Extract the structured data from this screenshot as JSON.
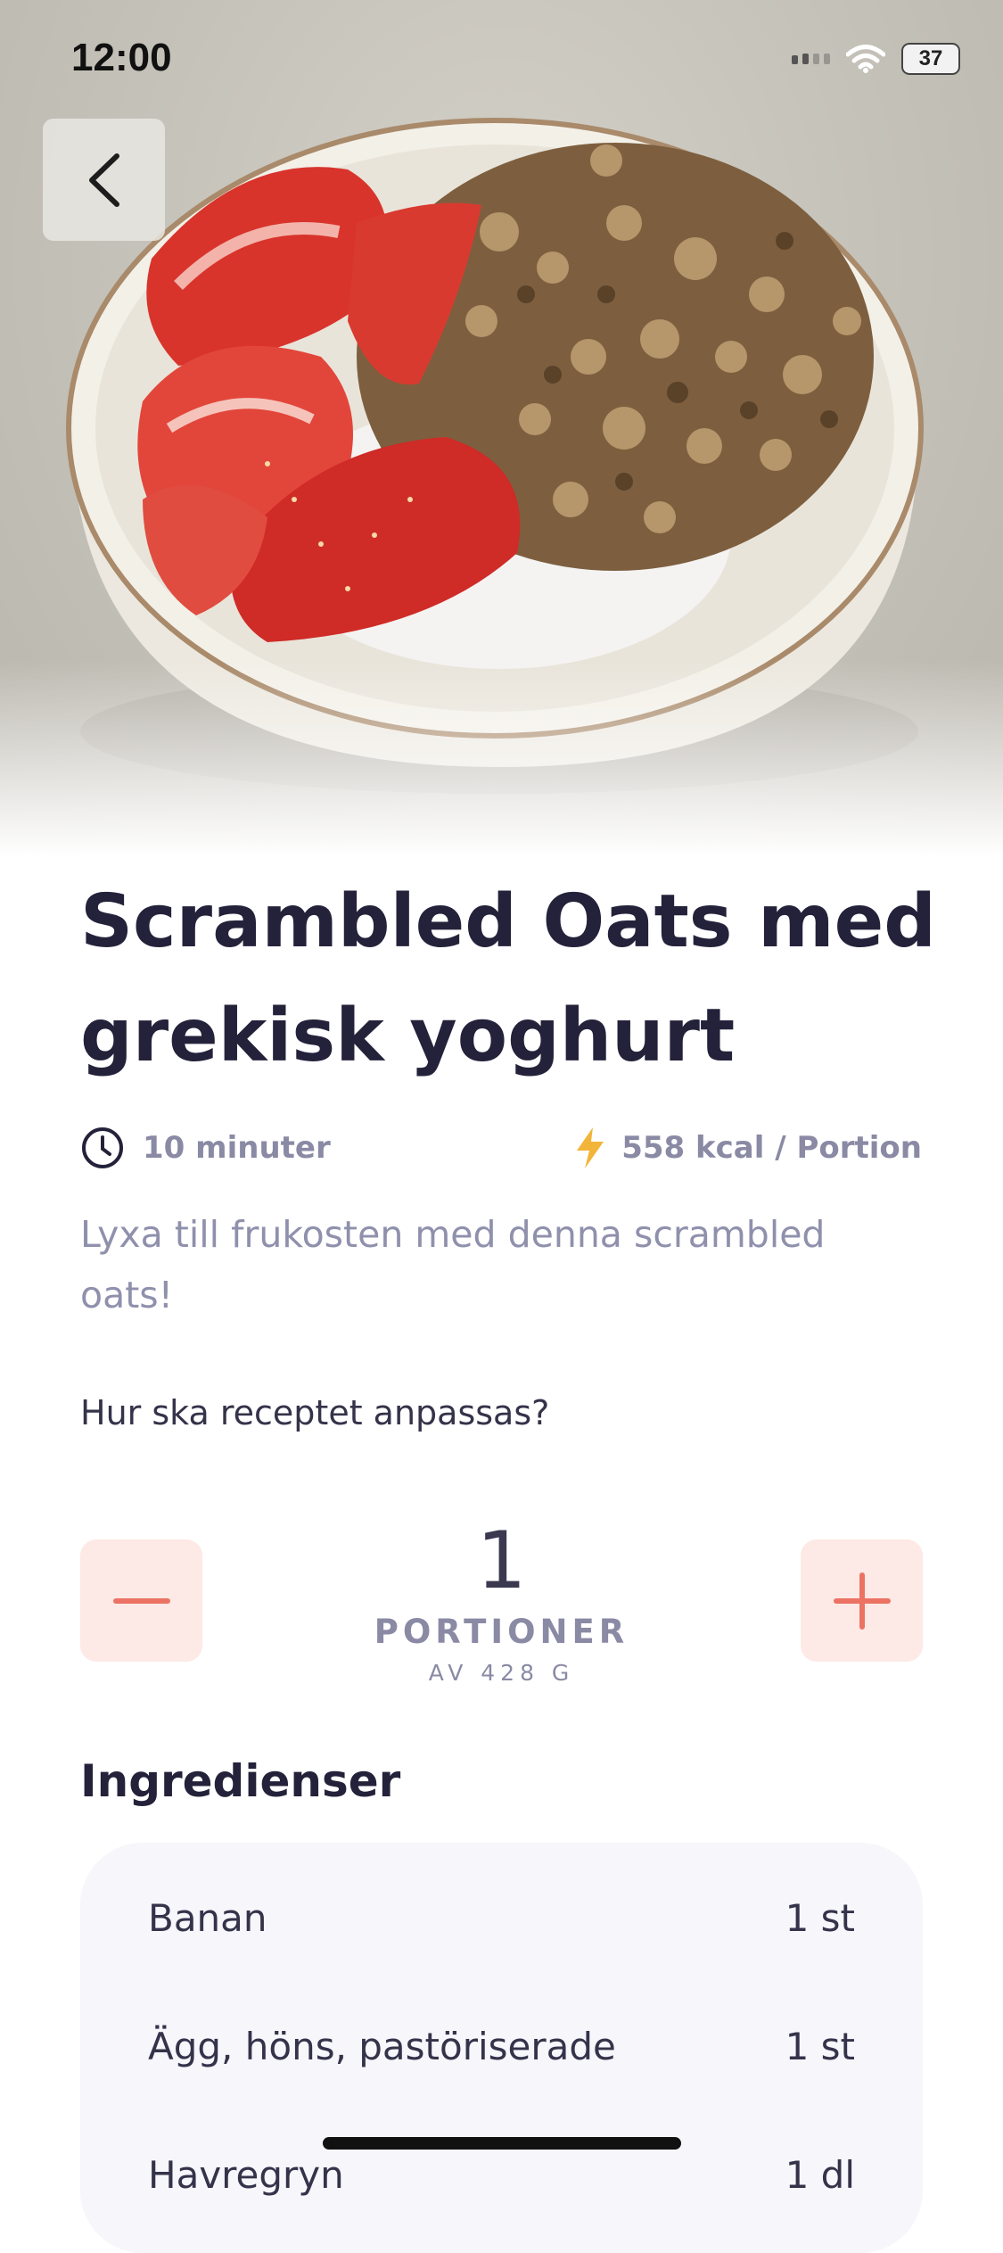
{
  "status_bar": {
    "time": "12:00",
    "battery": "37"
  },
  "recipe": {
    "title": "Scrambled Oats med grekisk yoghurt",
    "time": "10 minuter",
    "kcal": "558 kcal / Portion",
    "description": "Lyxa till frukosten med denna scrambled oats!"
  },
  "adjust": {
    "question": "Hur ska receptet anpassas?",
    "portions": "1",
    "portions_label": "PORTIONER",
    "weight": "AV 428 G"
  },
  "ingredients": {
    "heading": "Ingredienser",
    "items": [
      {
        "name": "Banan",
        "amount": "1 st"
      },
      {
        "name": "Ägg, höns, pastöriserade",
        "amount": "1 st"
      },
      {
        "name": "Havregryn",
        "amount": "1 dl"
      }
    ]
  },
  "colors": {
    "accent": "#ec7364",
    "accent_bg": "#fde9e5",
    "title": "#24223a",
    "muted": "#8a8aa5",
    "bolt": "#f2b53a",
    "card": "#f6f6fb"
  },
  "icons": [
    "back-arrow-icon",
    "clock-icon",
    "bolt-icon",
    "minus-icon",
    "plus-icon",
    "wifi-icon",
    "signal-icon",
    "battery-icon"
  ]
}
